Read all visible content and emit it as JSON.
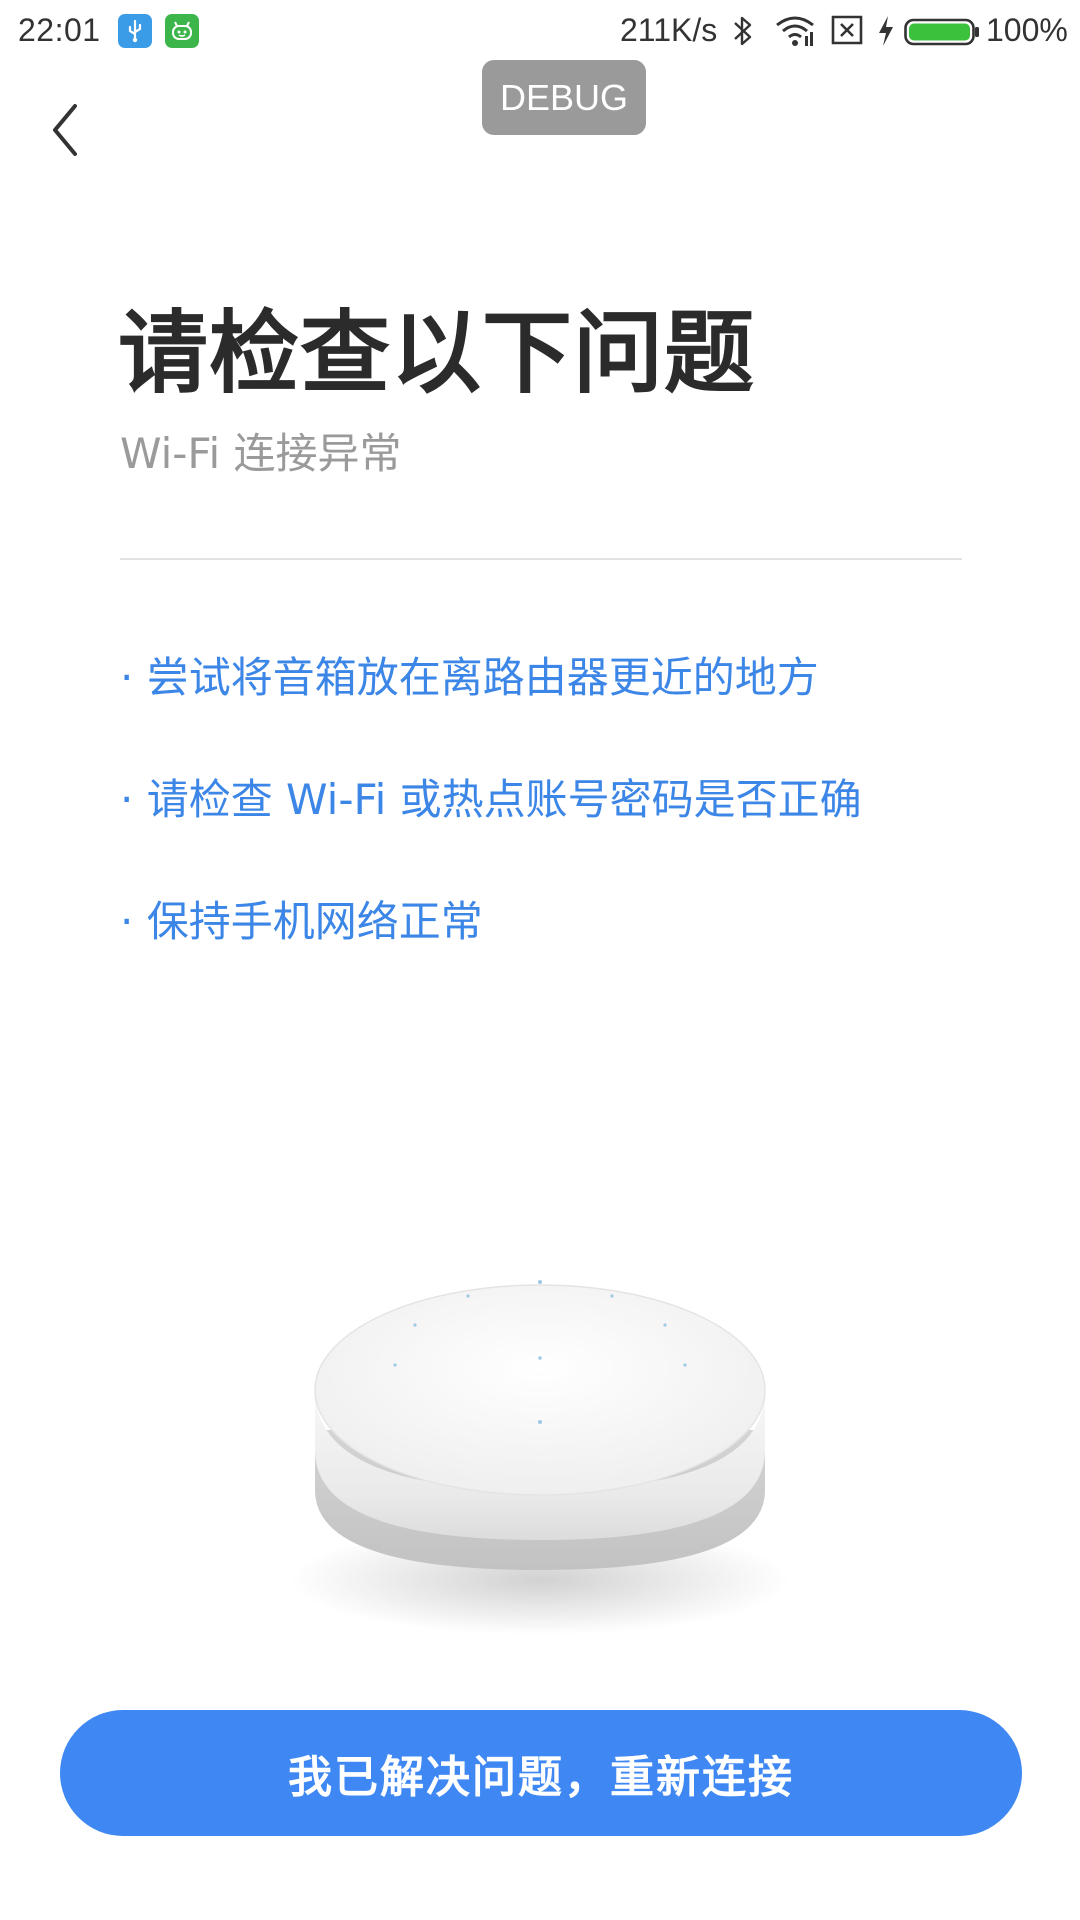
{
  "status_bar": {
    "time": "22:01",
    "net_speed": "211K/s",
    "battery_percent": "100%",
    "battery_level": 1.0,
    "icons": [
      "usb-icon",
      "robot-icon",
      "bluetooth-icon",
      "wifi-icon",
      "sim-off-icon",
      "charging-icon",
      "battery-icon"
    ]
  },
  "debug_badge": "DEBUG",
  "header": {
    "back_icon": "chevron-left-icon"
  },
  "main": {
    "title": "请检查以下问题",
    "subtitle": "Wi-Fi 连接异常",
    "tips": [
      "· 尝试将音箱放在离路由器更近的地方",
      "· 请检查 Wi-Fi 或热点账号密码是否正确",
      "· 保持手机网络正常"
    ]
  },
  "actions": {
    "reconnect_label": "我已解决问题，重新连接"
  },
  "colors": {
    "accent": "#3f88f3",
    "tip_text": "#3b86e6",
    "title_text": "#2b2b2b",
    "subtitle_text": "#9a9a9a"
  }
}
